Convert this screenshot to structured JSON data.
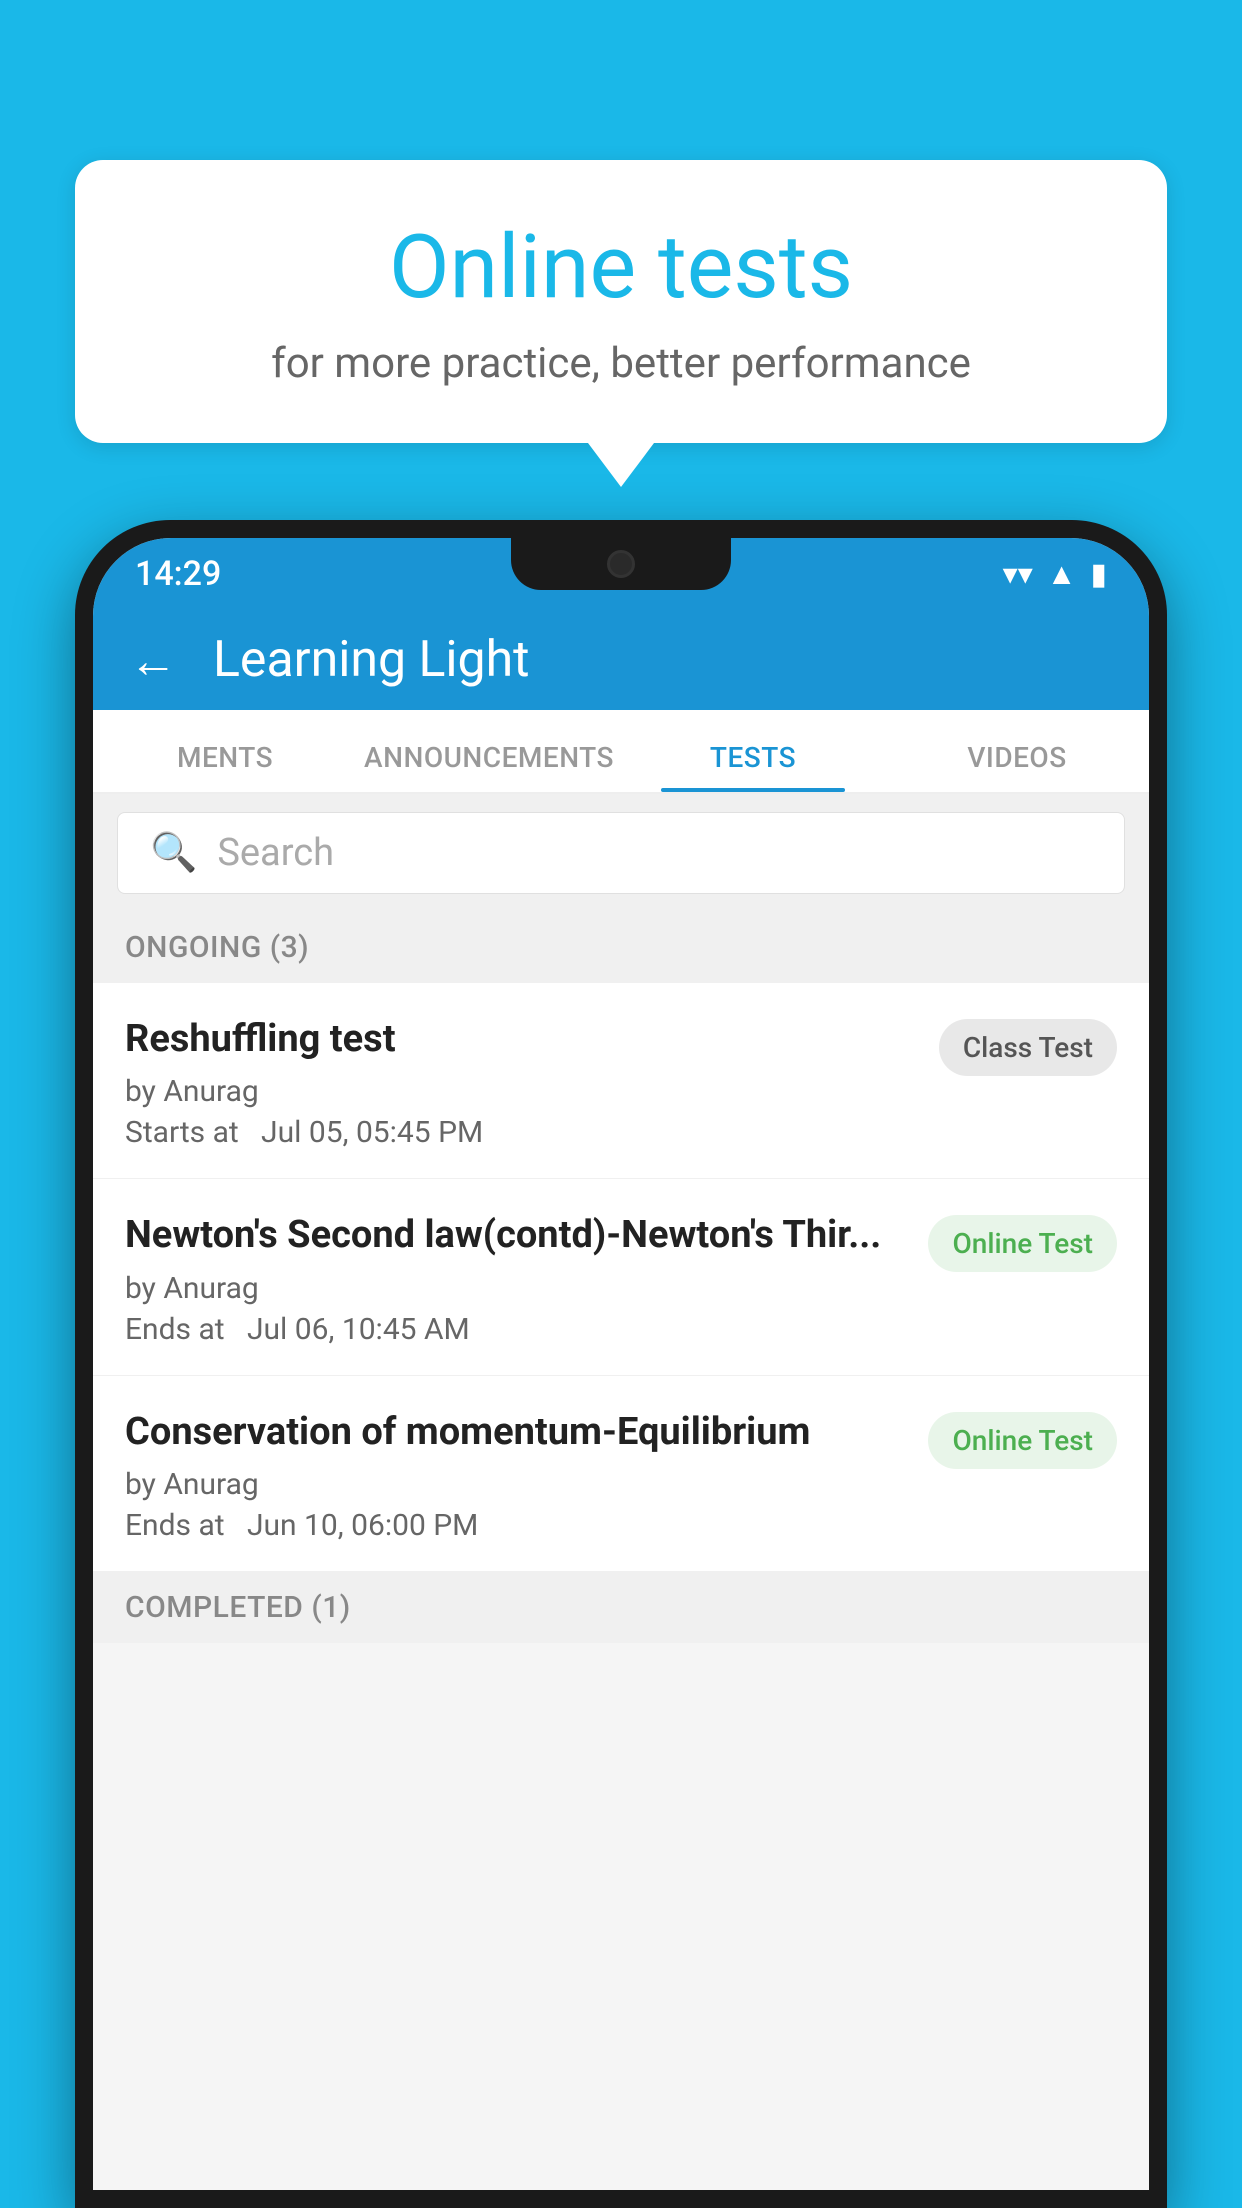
{
  "background_color": "#1ab8e8",
  "speech_bubble": {
    "title": "Online tests",
    "subtitle": "for more practice, better performance"
  },
  "phone": {
    "status_bar": {
      "time": "14:29",
      "wifi": "▾",
      "signal": "◀",
      "battery": "▮"
    },
    "header": {
      "back_label": "←",
      "title": "Learning Light"
    },
    "tabs": [
      {
        "label": "MENTS",
        "active": false
      },
      {
        "label": "ANNOUNCEMENTS",
        "active": false
      },
      {
        "label": "TESTS",
        "active": true
      },
      {
        "label": "VIDEOS",
        "active": false
      }
    ],
    "search": {
      "placeholder": "Search"
    },
    "ongoing_section": {
      "label": "ONGOING (3)"
    },
    "test_items": [
      {
        "name": "Reshuffling test",
        "author": "by Anurag",
        "time_label": "Starts at",
        "time_value": "Jul 05, 05:45 PM",
        "badge": "Class Test",
        "badge_type": "class"
      },
      {
        "name": "Newton's Second law(contd)-Newton's Thir...",
        "author": "by Anurag",
        "time_label": "Ends at",
        "time_value": "Jul 06, 10:45 AM",
        "badge": "Online Test",
        "badge_type": "online"
      },
      {
        "name": "Conservation of momentum-Equilibrium",
        "author": "by Anurag",
        "time_label": "Ends at",
        "time_value": "Jun 10, 06:00 PM",
        "badge": "Online Test",
        "badge_type": "online"
      }
    ],
    "completed_section": {
      "label": "COMPLETED (1)"
    }
  }
}
